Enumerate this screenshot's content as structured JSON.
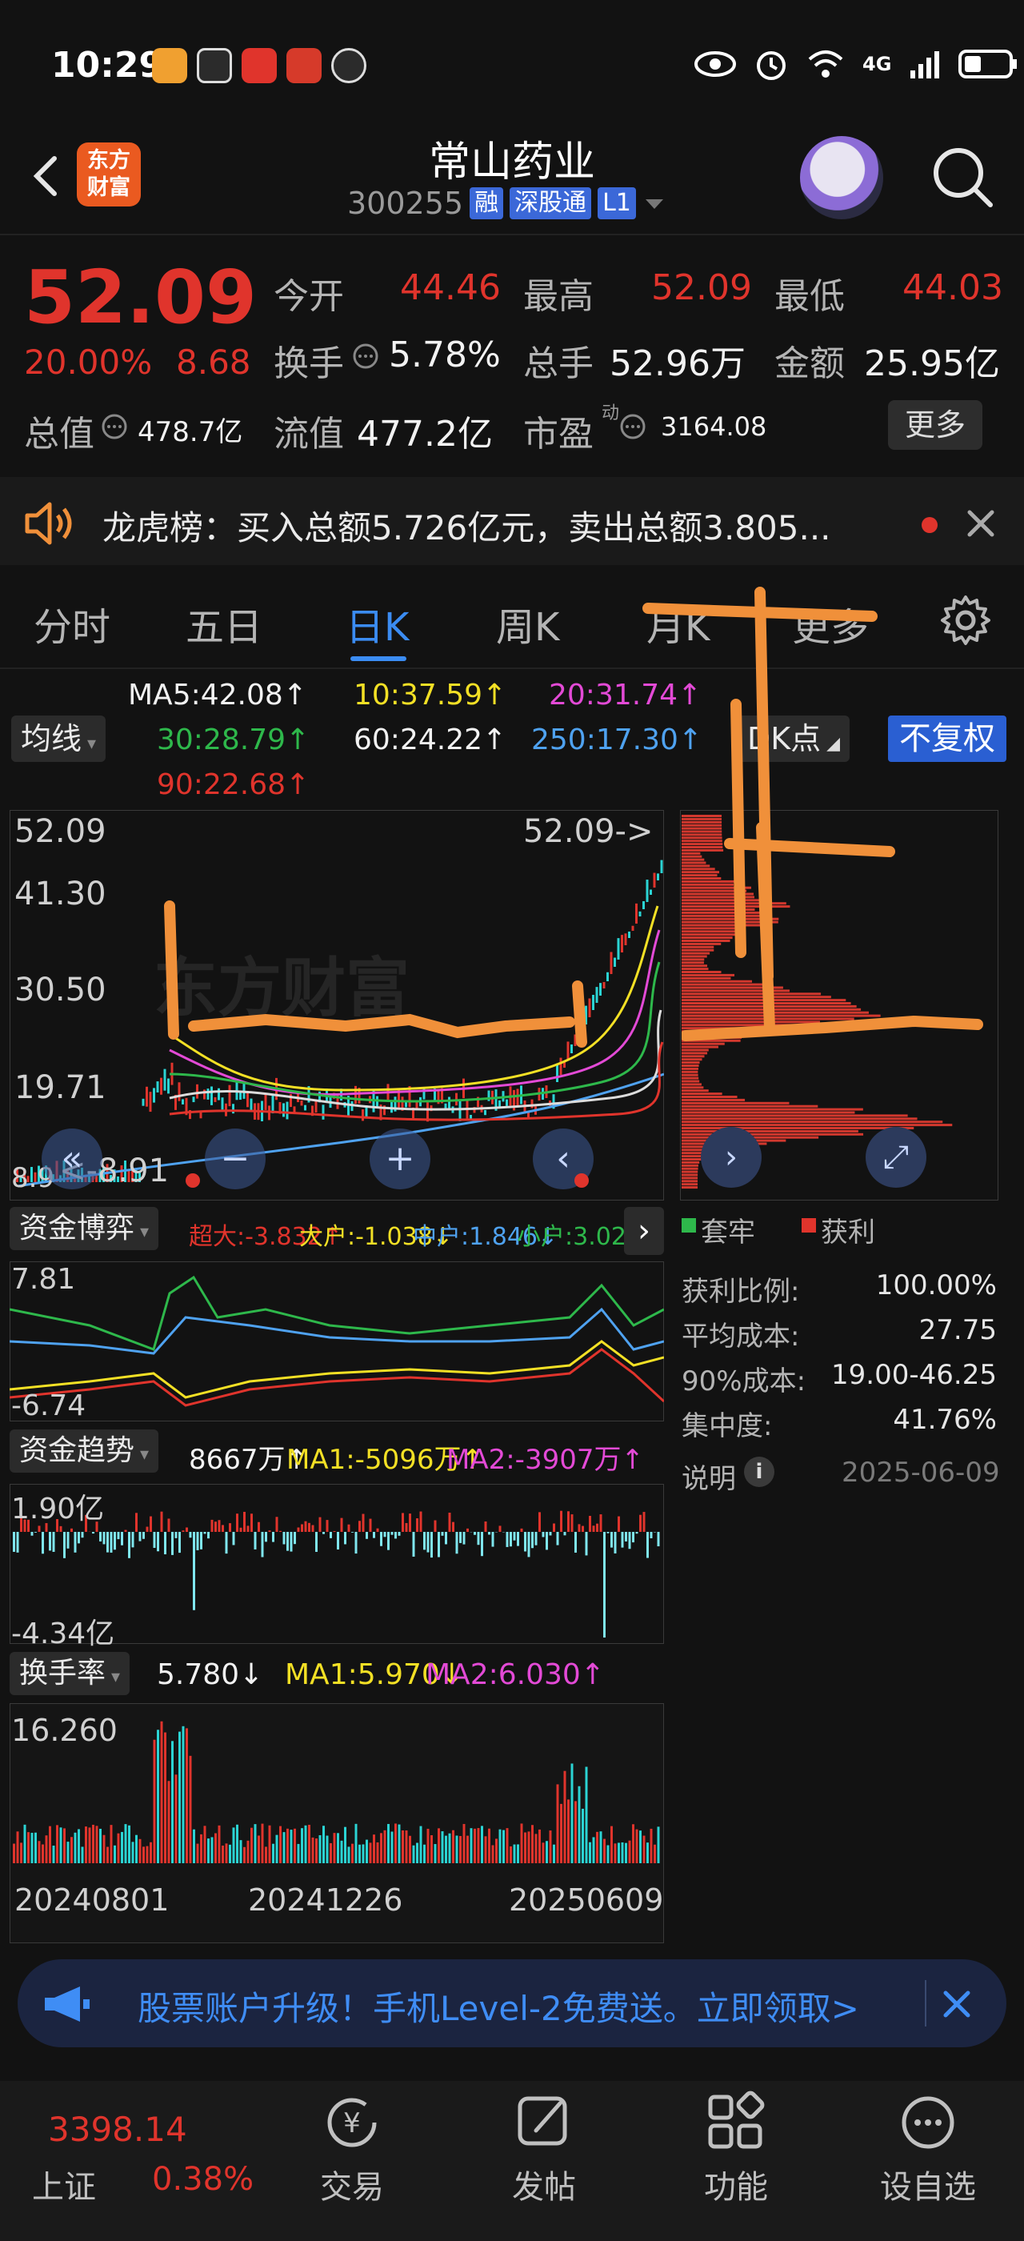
{
  "status_bar": {
    "time": "10:29",
    "network": "4G"
  },
  "header": {
    "app_logo": "东方财富",
    "stock_name": "常山药业",
    "code": "300255",
    "badges": [
      "融",
      "深股通",
      "L1"
    ]
  },
  "quote": {
    "price": "52.09",
    "change_pct": "20.00%",
    "change_amt": "8.68",
    "open_label": "今开",
    "open": "44.46",
    "high_label": "最高",
    "high": "52.09",
    "low_label": "最低",
    "low": "44.03",
    "turnover_label": "换手",
    "turnover": "5.78%",
    "volume_label": "总手",
    "volume": "52.96万",
    "amount_label": "金额",
    "amount": "25.95亿",
    "mktcap_label": "总值",
    "mktcap": "478.7亿",
    "float_label": "流值",
    "float_cap": "477.2亿",
    "pe_label": "市盈",
    "pe_sup": "动",
    "pe": "3164.08",
    "more_label": "更多"
  },
  "banner": {
    "text": "龙虎榜：买入总额5.726亿元，卖出总额3.805..."
  },
  "tabs": [
    "分时",
    "五日",
    "日K",
    "周K",
    "月K",
    "更多"
  ],
  "ma_legend": {
    "selector": "均线",
    "ma5": "MA5:42.08↑",
    "ma10": "10:37.59↑",
    "ma20": "20:31.74↑",
    "ma30": "30:28.79↑",
    "ma60": "60:24.22↑",
    "ma250": "250:17.30↑",
    "ma90": "90:22.68↑",
    "dk_label": "DK点",
    "fq_label": "不复权"
  },
  "main_chart": {
    "y_labels": [
      "52.09",
      "41.30",
      "30.50",
      "19.71"
    ],
    "last_label": "52.09->",
    "bottom_left": "8.9",
    "range_label": "<-8.91",
    "watermark": "东方财富"
  },
  "capital_game": {
    "selector": "资金博弈",
    "super": "超大:-3.832↑",
    "large": "大户:-1.038↓",
    "mid": "中户:1.846↓",
    "small": "小户:3.022↓",
    "y_max": "7.81",
    "y_min": "-6.74"
  },
  "capital_trend": {
    "selector": "资金趋势",
    "value": "8667万↑",
    "ma1": "MA1:-5096万↑",
    "ma2": "MA2:-3907万↑",
    "y_max": "1.90亿",
    "y_min": "-4.34亿"
  },
  "turnover": {
    "selector": "换手率",
    "value": "5.780↓",
    "ma1": "MA1:5.970↓",
    "ma2": "MA2:6.030↑",
    "y_max": "16.260",
    "dates": [
      "20240801",
      "20241226",
      "20250609"
    ]
  },
  "cost_dist": {
    "legend_firm": "套牢",
    "legend_profit": "获利",
    "rows": [
      {
        "label": "获利比例:",
        "value": "100.00%"
      },
      {
        "label": "平均成本:",
        "value": "27.75"
      },
      {
        "label": "90%成本:",
        "value": "19.00-46.25"
      },
      {
        "label": "集中度:",
        "value": "41.76%"
      }
    ],
    "note_label": "说明",
    "date": "2025-06-09"
  },
  "promo": {
    "text": "股票账户升级！手机Level-2免费送。立即领取>"
  },
  "bottom_nav": {
    "index_value": "3398.14",
    "index_name": "上证",
    "index_change": "0.38%",
    "items": [
      "交易",
      "发帖",
      "功能",
      "设自选"
    ]
  },
  "colors": {
    "up": "#e0342c",
    "down": "#2eb84b",
    "accent": "#3b8cf2",
    "annotation": "#f0903a"
  }
}
